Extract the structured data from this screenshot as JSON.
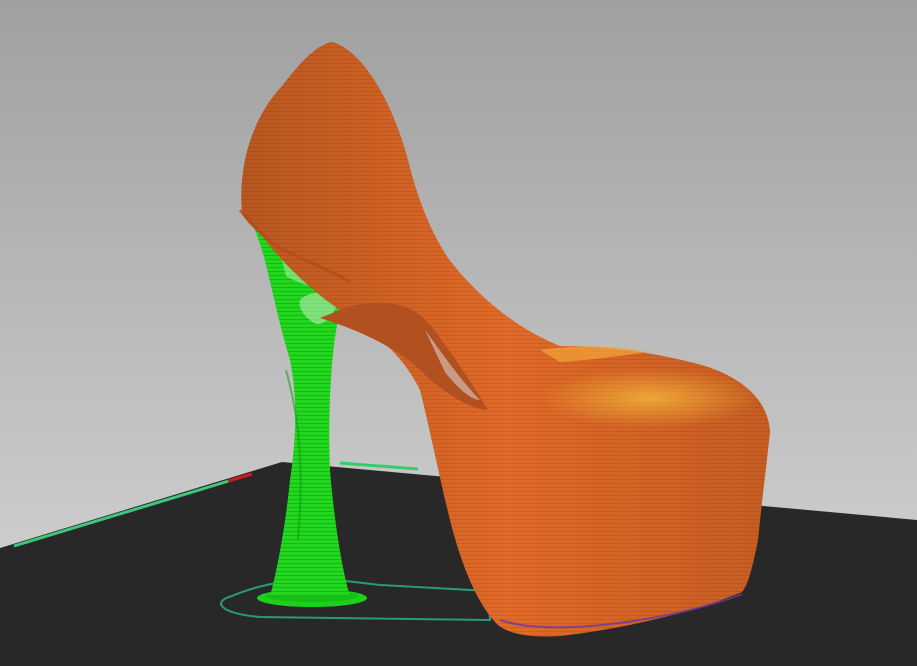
{
  "app": {
    "view": "3d-gcode-preview",
    "background_top": "#a0a0a0",
    "background_bottom": "#d6d6d6"
  },
  "bed": {
    "color": "#282828",
    "axis_x_color": "#2fd06a",
    "axis_x_neg_color": "#d01a1a",
    "axis_y_color": "#3ec77a"
  },
  "print": {
    "model": "high-heel-shoe",
    "feature_colors": {
      "perimeter": "#e06a28",
      "perimeter_shade": "#c9571c",
      "top_solid_infill": "#f0a030",
      "support": "#21d51d",
      "support_dark": "#12a812",
      "skirt": "#2a9a7a",
      "wipe_edge": "#6a3aa0"
    }
  }
}
